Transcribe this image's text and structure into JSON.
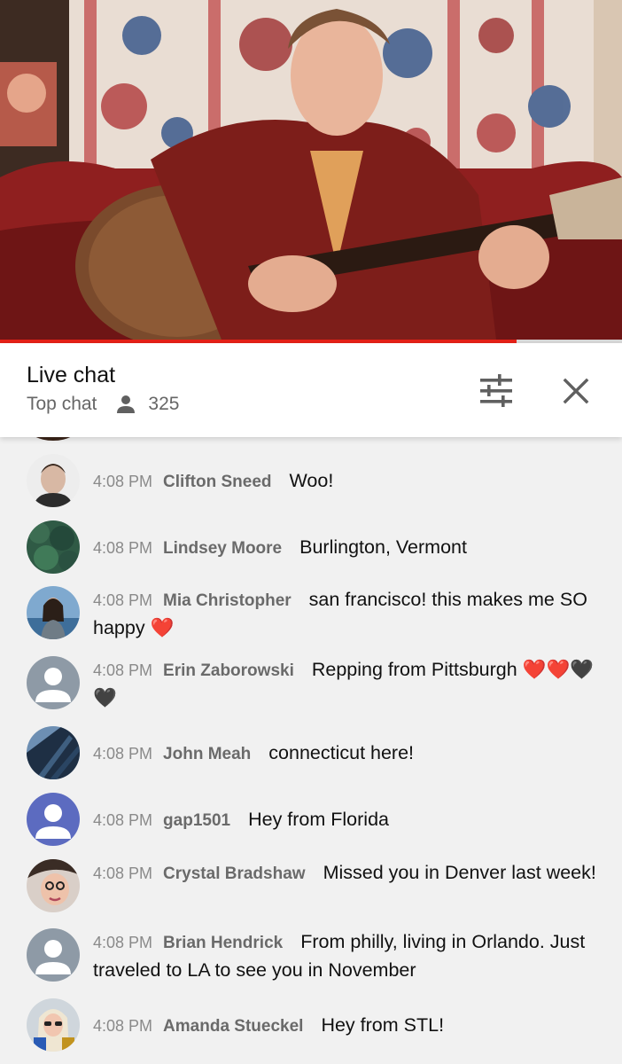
{
  "video": {
    "progress_fraction": 0.83
  },
  "header": {
    "title": "Live chat",
    "mode": "Top chat",
    "viewer_count": "325",
    "viewer_icon": "person-icon",
    "filter_icon": "tune-icon",
    "close_icon": "close-icon"
  },
  "messages": [
    {
      "time": "4:08 PM",
      "author": "Clifton Sneed",
      "text": "Woo!",
      "avatar": "photo"
    },
    {
      "time": "4:08 PM",
      "author": "Lindsey Moore",
      "text": "Burlington, Vermont",
      "avatar": "photo"
    },
    {
      "time": "4:08 PM",
      "author": "Mia Christopher",
      "text": "san francisco! this makes me SO happy ❤️",
      "avatar": "photo"
    },
    {
      "time": "4:08 PM",
      "author": "Erin Zaborowski",
      "text": "Repping from Pittsburgh ❤️❤️🖤🖤",
      "avatar": "default-grey"
    },
    {
      "time": "4:08 PM",
      "author": "John Meah",
      "text": "connecticut here!",
      "avatar": "photo"
    },
    {
      "time": "4:08 PM",
      "author": "gap1501",
      "text": "Hey from Florida",
      "avatar": "default-purple"
    },
    {
      "time": "4:08 PM",
      "author": "Crystal Bradshaw",
      "text": "Missed you in Denver last week!",
      "avatar": "photo"
    },
    {
      "time": "4:08 PM",
      "author": "Brian Hendrick",
      "text": "From philly, living in Orlando. Just traveled to LA to see you in November",
      "avatar": "default-grey"
    },
    {
      "time": "4:08 PM",
      "author": "Amanda Stueckel",
      "text": "Hey from STL!",
      "avatar": "photo"
    }
  ],
  "colors": {
    "progress": "#e62117",
    "chat_bg": "#f1f1f1",
    "header_bg": "#ffffff",
    "default_avatar_grey": "#8e9aa6",
    "default_avatar_purple": "#5c6bc0"
  }
}
